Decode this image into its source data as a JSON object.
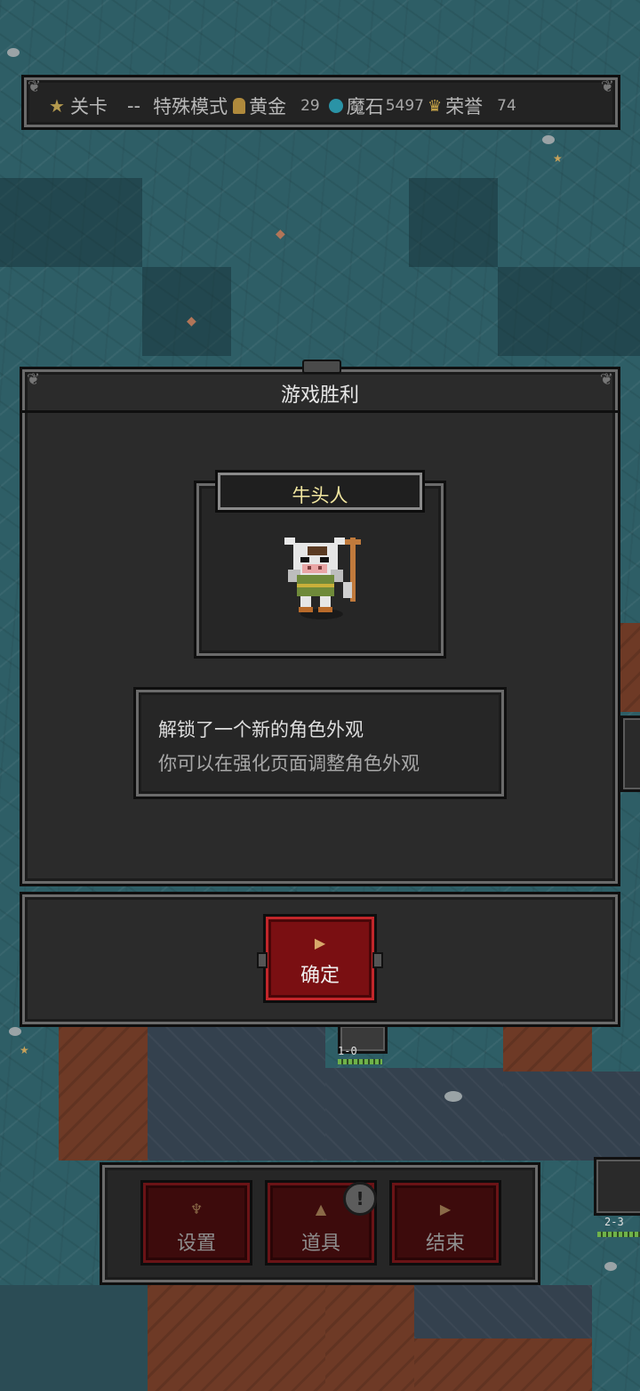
{
  "top_bar": {
    "stage_label": "关卡",
    "stage_value": "--",
    "mode": "特殊模式",
    "gold_label": "黄金",
    "gold_value": "29",
    "magic_stone_label": "魔石",
    "magic_stone_value": "5497",
    "honor_label": "荣誉",
    "honor_value": "74"
  },
  "victory_dialog": {
    "title": "游戏胜利",
    "character_name": "牛头人",
    "message_line1": "解锁了一个新的角色外观",
    "message_line2": "你可以在强化页面调整角色外观",
    "confirm_label": "确定"
  },
  "bottom_menu": {
    "settings_label": "设置",
    "items_label": "道具",
    "end_label": "结束",
    "items_alert": "!"
  },
  "map_units": {
    "unit_a_label": "1-0",
    "unit_b_label": "2-3"
  },
  "colors": {
    "water": "#2e5e66",
    "panel": "#2b2b2b",
    "confirm_red": "#7a0f12",
    "name_yellow": "#f2e7a0"
  }
}
